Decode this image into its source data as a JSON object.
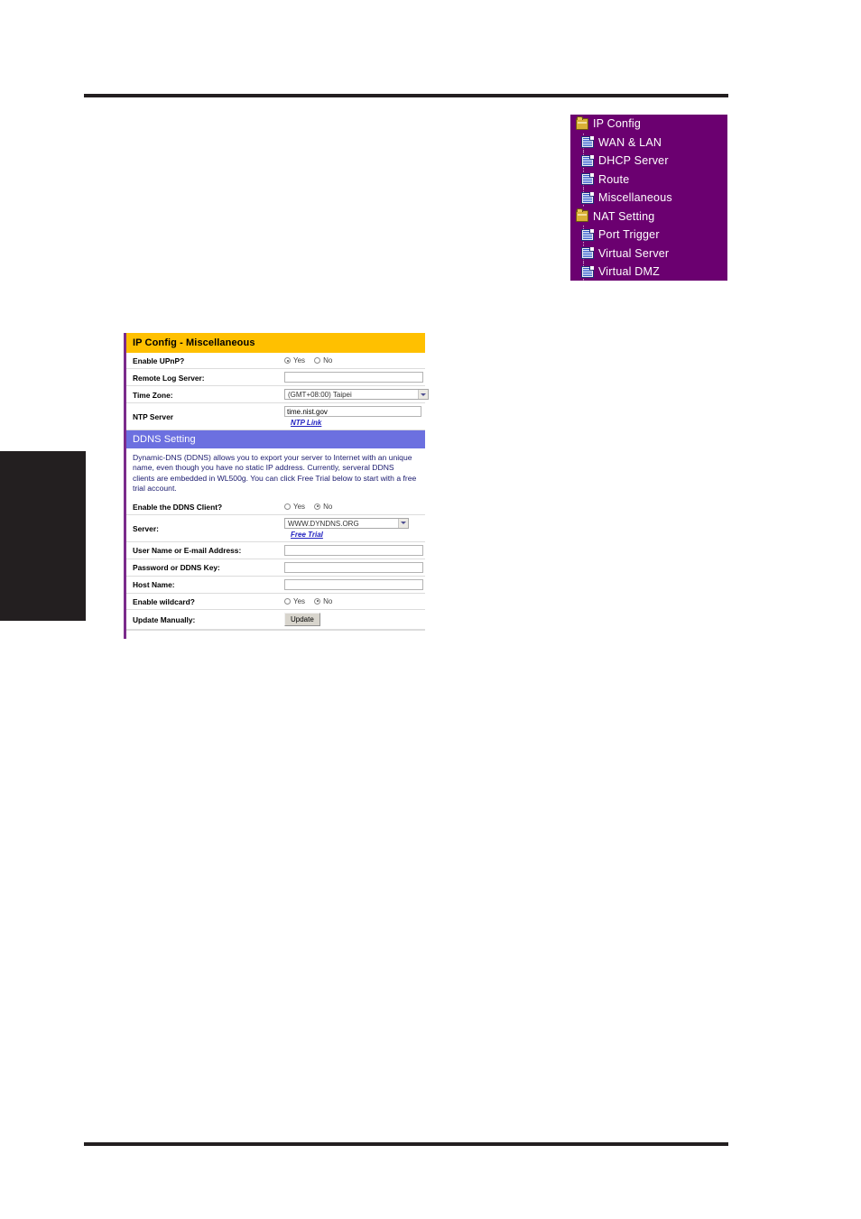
{
  "sidebar": {
    "background_color": "#6b0070",
    "items": [
      {
        "label": "IP Config",
        "icon": "folder-icon",
        "level": 0
      },
      {
        "label": "WAN & LAN",
        "icon": "document-icon",
        "level": 1
      },
      {
        "label": "DHCP Server",
        "icon": "document-icon",
        "level": 1
      },
      {
        "label": "Route",
        "icon": "document-icon",
        "level": 1
      },
      {
        "label": "Miscellaneous",
        "icon": "document-icon",
        "level": 1
      },
      {
        "label": "NAT Setting",
        "icon": "folder-icon",
        "level": 0
      },
      {
        "label": "Port Trigger",
        "icon": "document-icon",
        "level": 1
      },
      {
        "label": "Virtual Server",
        "icon": "document-icon",
        "level": 1
      },
      {
        "label": "Virtual DMZ",
        "icon": "document-icon",
        "level": 1
      }
    ]
  },
  "panel": {
    "title": "IP Config - Miscellaneous",
    "title_bg_color": "#ffc000",
    "accent_color": "#7b2b8c",
    "rows": {
      "upnp": {
        "label": "Enable UPnP?",
        "yes": "Yes",
        "no": "No",
        "selected": "Yes"
      },
      "remote_log": {
        "label": "Remote Log Server:",
        "value": ""
      },
      "time_zone": {
        "label": "Time Zone:",
        "value": "(GMT+08:00) Taipei"
      },
      "ntp_server": {
        "label": "NTP Server",
        "value": "time.nist.gov",
        "link": "NTP Link"
      }
    }
  },
  "ddns": {
    "section_title": "DDNS Setting",
    "section_bg_color": "#6c70e0",
    "description": "Dynamic-DNS (DDNS) allows you to export your server to Internet with an unique name, even though you have no static IP address. Currently, serveral DDNS clients are embedded in WL500g. You can click Free Trial below to start with a free trial account.",
    "rows": {
      "enable_client": {
        "label": "Enable the DDNS Client?",
        "yes": "Yes",
        "no": "No",
        "selected": "No"
      },
      "server": {
        "label": "Server:",
        "value": "WWW.DYNDNS.ORG",
        "link": "Free Trial"
      },
      "user_name": {
        "label": "User Name or E-mail Address:",
        "value": ""
      },
      "password": {
        "label": "Password or DDNS Key:",
        "value": ""
      },
      "host_name": {
        "label": "Host Name:",
        "value": ""
      },
      "wildcard": {
        "label": "Enable wildcard?",
        "yes": "Yes",
        "no": "No",
        "selected": "No"
      },
      "update_manually": {
        "label": "Update Manually:",
        "button": "Update"
      }
    }
  }
}
